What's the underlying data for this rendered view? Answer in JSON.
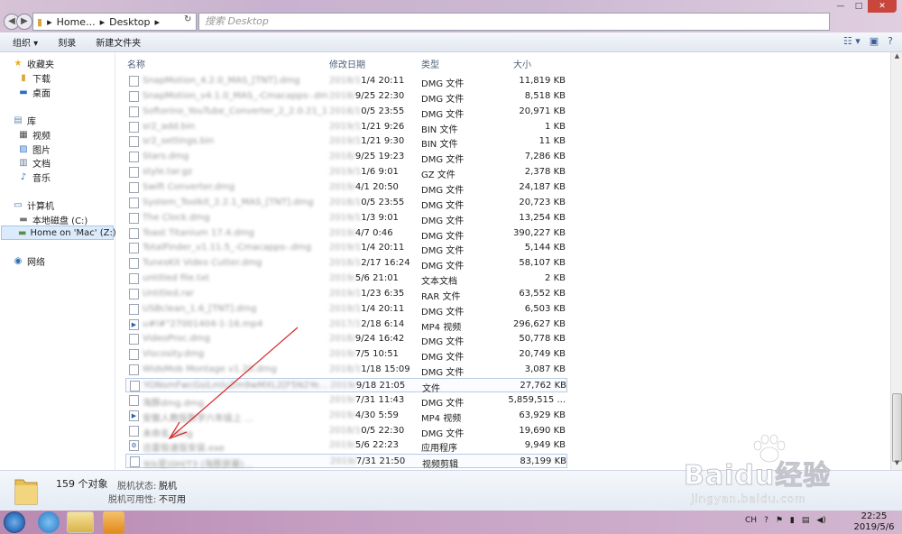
{
  "address": {
    "crumbs": [
      "Home...",
      "Desktop"
    ]
  },
  "search": {
    "placeholder": "搜索 Desktop"
  },
  "toolbar": {
    "organize": "组织",
    "burn": "刻录",
    "new_folder": "新建文件夹"
  },
  "nav": {
    "favorites": "收藏夹",
    "downloads": "下载",
    "desktop": "桌面",
    "libraries": "库",
    "videos": "视频",
    "pictures": "图片",
    "documents": "文档",
    "music": "音乐",
    "computer": "计算机",
    "local_disk": "本地磁盘 (C:)",
    "home_on_mac": "Home on 'Mac' (Z:)",
    "network": "网络"
  },
  "columns": {
    "name": "名称",
    "date": "修改日期",
    "type": "类型",
    "size": "大小"
  },
  "files": [
    {
      "name": "SnapMotion_4.2.0_MAS_[TNT].dmg",
      "date_hidden": "2018/1",
      "date_visible": "1/4 20:11",
      "type": "DMG 文件",
      "size": "11,819 KB",
      "icon": "file"
    },
    {
      "name": "SnapMotion_v4.1.0_MAS_-Cmacapps-.dmg",
      "date_hidden": "2018/",
      "date_visible": "9/25 22:30",
      "type": "DMG 文件",
      "size": "8,518 KB",
      "icon": "file"
    },
    {
      "name": "Softorino_YouTube_Converter_2_2.0.21_1.dmg",
      "date_hidden": "2018/1",
      "date_visible": "0/5 23:55",
      "type": "DMG 文件",
      "size": "20,971 KB",
      "icon": "file"
    },
    {
      "name": "sr2_add.bin",
      "date_hidden": "2019/1",
      "date_visible": "1/21 9:26",
      "type": "BIN 文件",
      "size": "1 KB",
      "icon": "file"
    },
    {
      "name": "sr2_settings.bin",
      "date_hidden": "2019/1",
      "date_visible": "1/21 9:30",
      "type": "BIN 文件",
      "size": "11 KB",
      "icon": "file"
    },
    {
      "name": "Stars.dmg",
      "date_hidden": "2018/",
      "date_visible": "9/25 19:23",
      "type": "DMG 文件",
      "size": "7,286 KB",
      "icon": "file"
    },
    {
      "name": "style.tar.gz",
      "date_hidden": "2019/1",
      "date_visible": "1/6 9:01",
      "type": "GZ 文件",
      "size": "2,378 KB",
      "icon": "file"
    },
    {
      "name": "Swift Converter.dmg",
      "date_hidden": "2019/",
      "date_visible": "4/1 20:50",
      "type": "DMG 文件",
      "size": "24,187 KB",
      "icon": "file"
    },
    {
      "name": "System_Toolkit_2.2.1_MAS_[TNT].dmg",
      "date_hidden": "2018/1",
      "date_visible": "0/5 23:55",
      "type": "DMG 文件",
      "size": "20,723 KB",
      "icon": "file"
    },
    {
      "name": "The Clock.dmg",
      "date_hidden": "2019/1",
      "date_visible": "1/3 9:01",
      "type": "DMG 文件",
      "size": "13,254 KB",
      "icon": "file"
    },
    {
      "name": "Toast Titanium 17.4.dmg",
      "date_hidden": "2019/",
      "date_visible": "4/7 0:46",
      "type": "DMG 文件",
      "size": "390,227 KB",
      "icon": "file"
    },
    {
      "name": "TotalFinder_v1.11.5_-Cmacapps-.dmg",
      "date_hidden": "2019/1",
      "date_visible": "1/4 20:11",
      "type": "DMG 文件",
      "size": "5,144 KB",
      "icon": "file"
    },
    {
      "name": "TunesKit Video Cutter.dmg",
      "date_hidden": "2018/1",
      "date_visible": "2/17 16:24",
      "type": "DMG 文件",
      "size": "58,107 KB",
      "icon": "file"
    },
    {
      "name": "untitled file.txt",
      "date_hidden": "2019/",
      "date_visible": "5/6 21:01",
      "type": "文本文档",
      "size": "2 KB",
      "icon": "file"
    },
    {
      "name": "Untitled.rar",
      "date_hidden": "2019/1",
      "date_visible": "1/23 6:35",
      "type": "RAR 文件",
      "size": "63,552 KB",
      "icon": "file"
    },
    {
      "name": "USBclean_1.6_[TNT].dmg",
      "date_hidden": "2019/1",
      "date_visible": "1/4 20:11",
      "type": "DMG 文件",
      "size": "6,503 KB",
      "icon": "file"
    },
    {
      "name": "u#l#\"27001404-1-16.mp4",
      "date_hidden": "2017/1",
      "date_visible": "2/18 6:14",
      "type": "MP4 视频",
      "size": "296,627 KB",
      "icon": "video"
    },
    {
      "name": "VideoProc.dmg",
      "date_hidden": "2018/",
      "date_visible": "9/24 16:42",
      "type": "DMG 文件",
      "size": "50,778 KB",
      "icon": "file"
    },
    {
      "name": "Viscosity.dmg",
      "date_hidden": "2019/",
      "date_visible": "7/5 10:51",
      "type": "DMG 文件",
      "size": "20,749 KB",
      "icon": "file"
    },
    {
      "name": "WidsMob Montage v1.20.dmg",
      "date_hidden": "2018/1",
      "date_visible": "1/18 15:09",
      "type": "DMG 文件",
      "size": "3,087 KB",
      "icon": "file"
    },
    {
      "name": "YONsmFwcGsiLmluZm9wMXL2[F5N2Ye...",
      "date_hidden": "2019/",
      "date_visible": "9/18 21:05",
      "type": "文件",
      "size": "27,762 KB",
      "icon": "file",
      "highlighted": true
    },
    {
      "name": "海豚dmg.dmg",
      "date_hidden": "2019/",
      "date_visible": "7/31 11:43",
      "type": "DMG 文件",
      "size": "5,859,515 ...",
      "icon": "file"
    },
    {
      "name": "安徽人教版数学六年级上 …",
      "date_hidden": "2019/",
      "date_visible": "4/30 5:59",
      "type": "MP4 视频",
      "size": "63,929 KB",
      "icon": "video"
    },
    {
      "name": "未命名.dmg",
      "date_hidden": "2018/1",
      "date_visible": "0/5 22:30",
      "type": "DMG 文件",
      "size": "19,690 KB",
      "icon": "file"
    },
    {
      "name": "迅雷极速版安装.exe",
      "date_hidden": "2019/",
      "date_visible": "5/6 22:23",
      "type": "应用程序",
      "size": "9,949 KB",
      "icon": "exe"
    },
    {
      "name": "9(k是)0H(T3 (海豚屏幕)…",
      "date_hidden": "2019/",
      "date_visible": "7/31 21:50",
      "type": "视频剪辑",
      "size": "83,199 KB",
      "icon": "file",
      "highlighted": true
    }
  ],
  "details": {
    "count": "159 个对象",
    "offline_status_label": "脱机状态:",
    "offline_status_value": "脱机",
    "offline_avail_label": "脱机可用性:",
    "offline_avail_value": "不可用"
  },
  "taskbar": {
    "time": "22:25",
    "date": "2019/5/6",
    "ime": "CH"
  },
  "watermark": {
    "brand": "Baidu经验",
    "url": "jingyan.baidu.com"
  },
  "colors": {
    "selected_bg": "#dcebfc",
    "arrow": "#d62a2a"
  }
}
